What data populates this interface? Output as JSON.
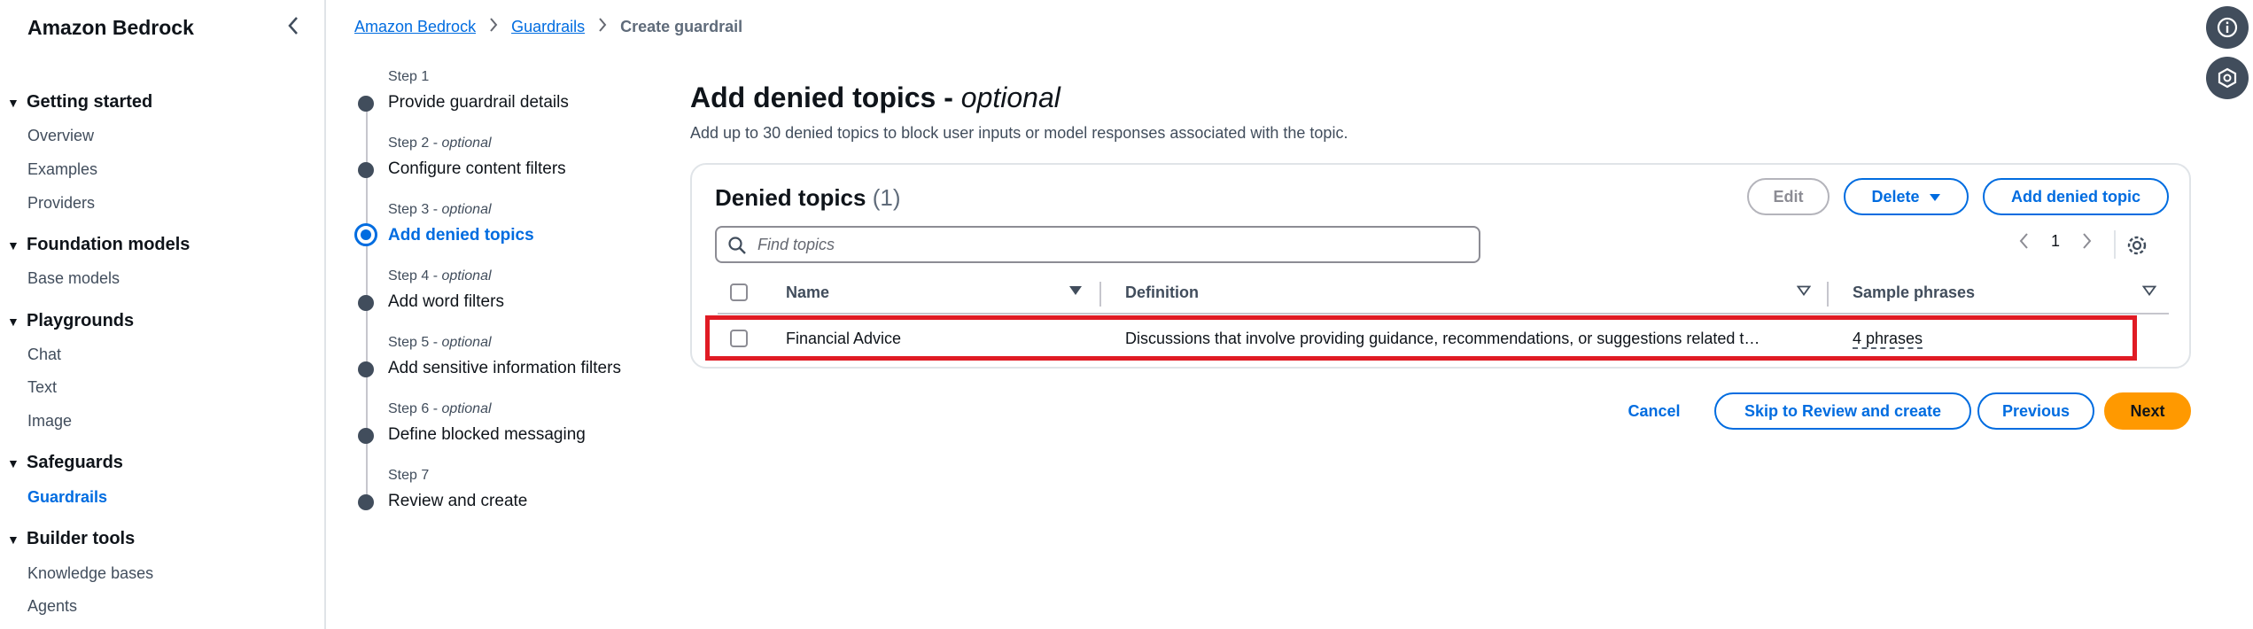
{
  "sidebar": {
    "title": "Amazon Bedrock",
    "groups": [
      {
        "label": "Getting started",
        "items": [
          "Overview",
          "Examples",
          "Providers"
        ]
      },
      {
        "label": "Foundation models",
        "items": [
          "Base models"
        ]
      },
      {
        "label": "Playgrounds",
        "items": [
          "Chat",
          "Text",
          "Image"
        ]
      },
      {
        "label": "Safeguards",
        "items": [
          "Guardrails"
        ]
      },
      {
        "label": "Builder tools",
        "items": [
          "Knowledge bases",
          "Agents"
        ]
      }
    ],
    "active_item": "Guardrails"
  },
  "breadcrumb": {
    "items": [
      "Amazon Bedrock",
      "Guardrails"
    ],
    "current": "Create guardrail"
  },
  "wizard": {
    "current_step": 3,
    "steps": [
      {
        "label": "Step 1",
        "optional": "",
        "title": "Provide guardrail details"
      },
      {
        "label": "Step 2 - ",
        "optional": "optional",
        "title": "Configure content filters"
      },
      {
        "label": "Step 3 - ",
        "optional": "optional",
        "title": "Add denied topics"
      },
      {
        "label": "Step 4 - ",
        "optional": "optional",
        "title": "Add word filters"
      },
      {
        "label": "Step 5 - ",
        "optional": "optional",
        "title": "Add sensitive information filters"
      },
      {
        "label": "Step 6 - ",
        "optional": "optional",
        "title": "Define blocked messaging"
      },
      {
        "label": "Step 7",
        "optional": "",
        "title": "Review and create"
      }
    ]
  },
  "page": {
    "title": "Add denied topics - ",
    "title_optional": "optional",
    "description": "Add up to 30 denied topics to block user inputs or model responses associated with the topic."
  },
  "denied_topics": {
    "title": "Denied topics",
    "count": "(1)",
    "buttons": {
      "edit": "Edit",
      "delete": "Delete",
      "add": "Add denied topic"
    },
    "search_placeholder": "Find topics",
    "page_number": "1",
    "columns": [
      "Name",
      "Definition",
      "Sample phrases"
    ],
    "rows": [
      {
        "name": "Financial Advice",
        "definition": "Discussions that involve providing guidance, recommendations, or suggestions related t…",
        "sample_phrases": "4 phrases"
      }
    ]
  },
  "footer": {
    "cancel": "Cancel",
    "skip": "Skip to Review and create",
    "previous": "Previous",
    "next": "Next"
  },
  "colors": {
    "link": "#006ce0",
    "primary_button": "#ff9900",
    "highlight": "#e01b24",
    "text": "#0f141a"
  }
}
